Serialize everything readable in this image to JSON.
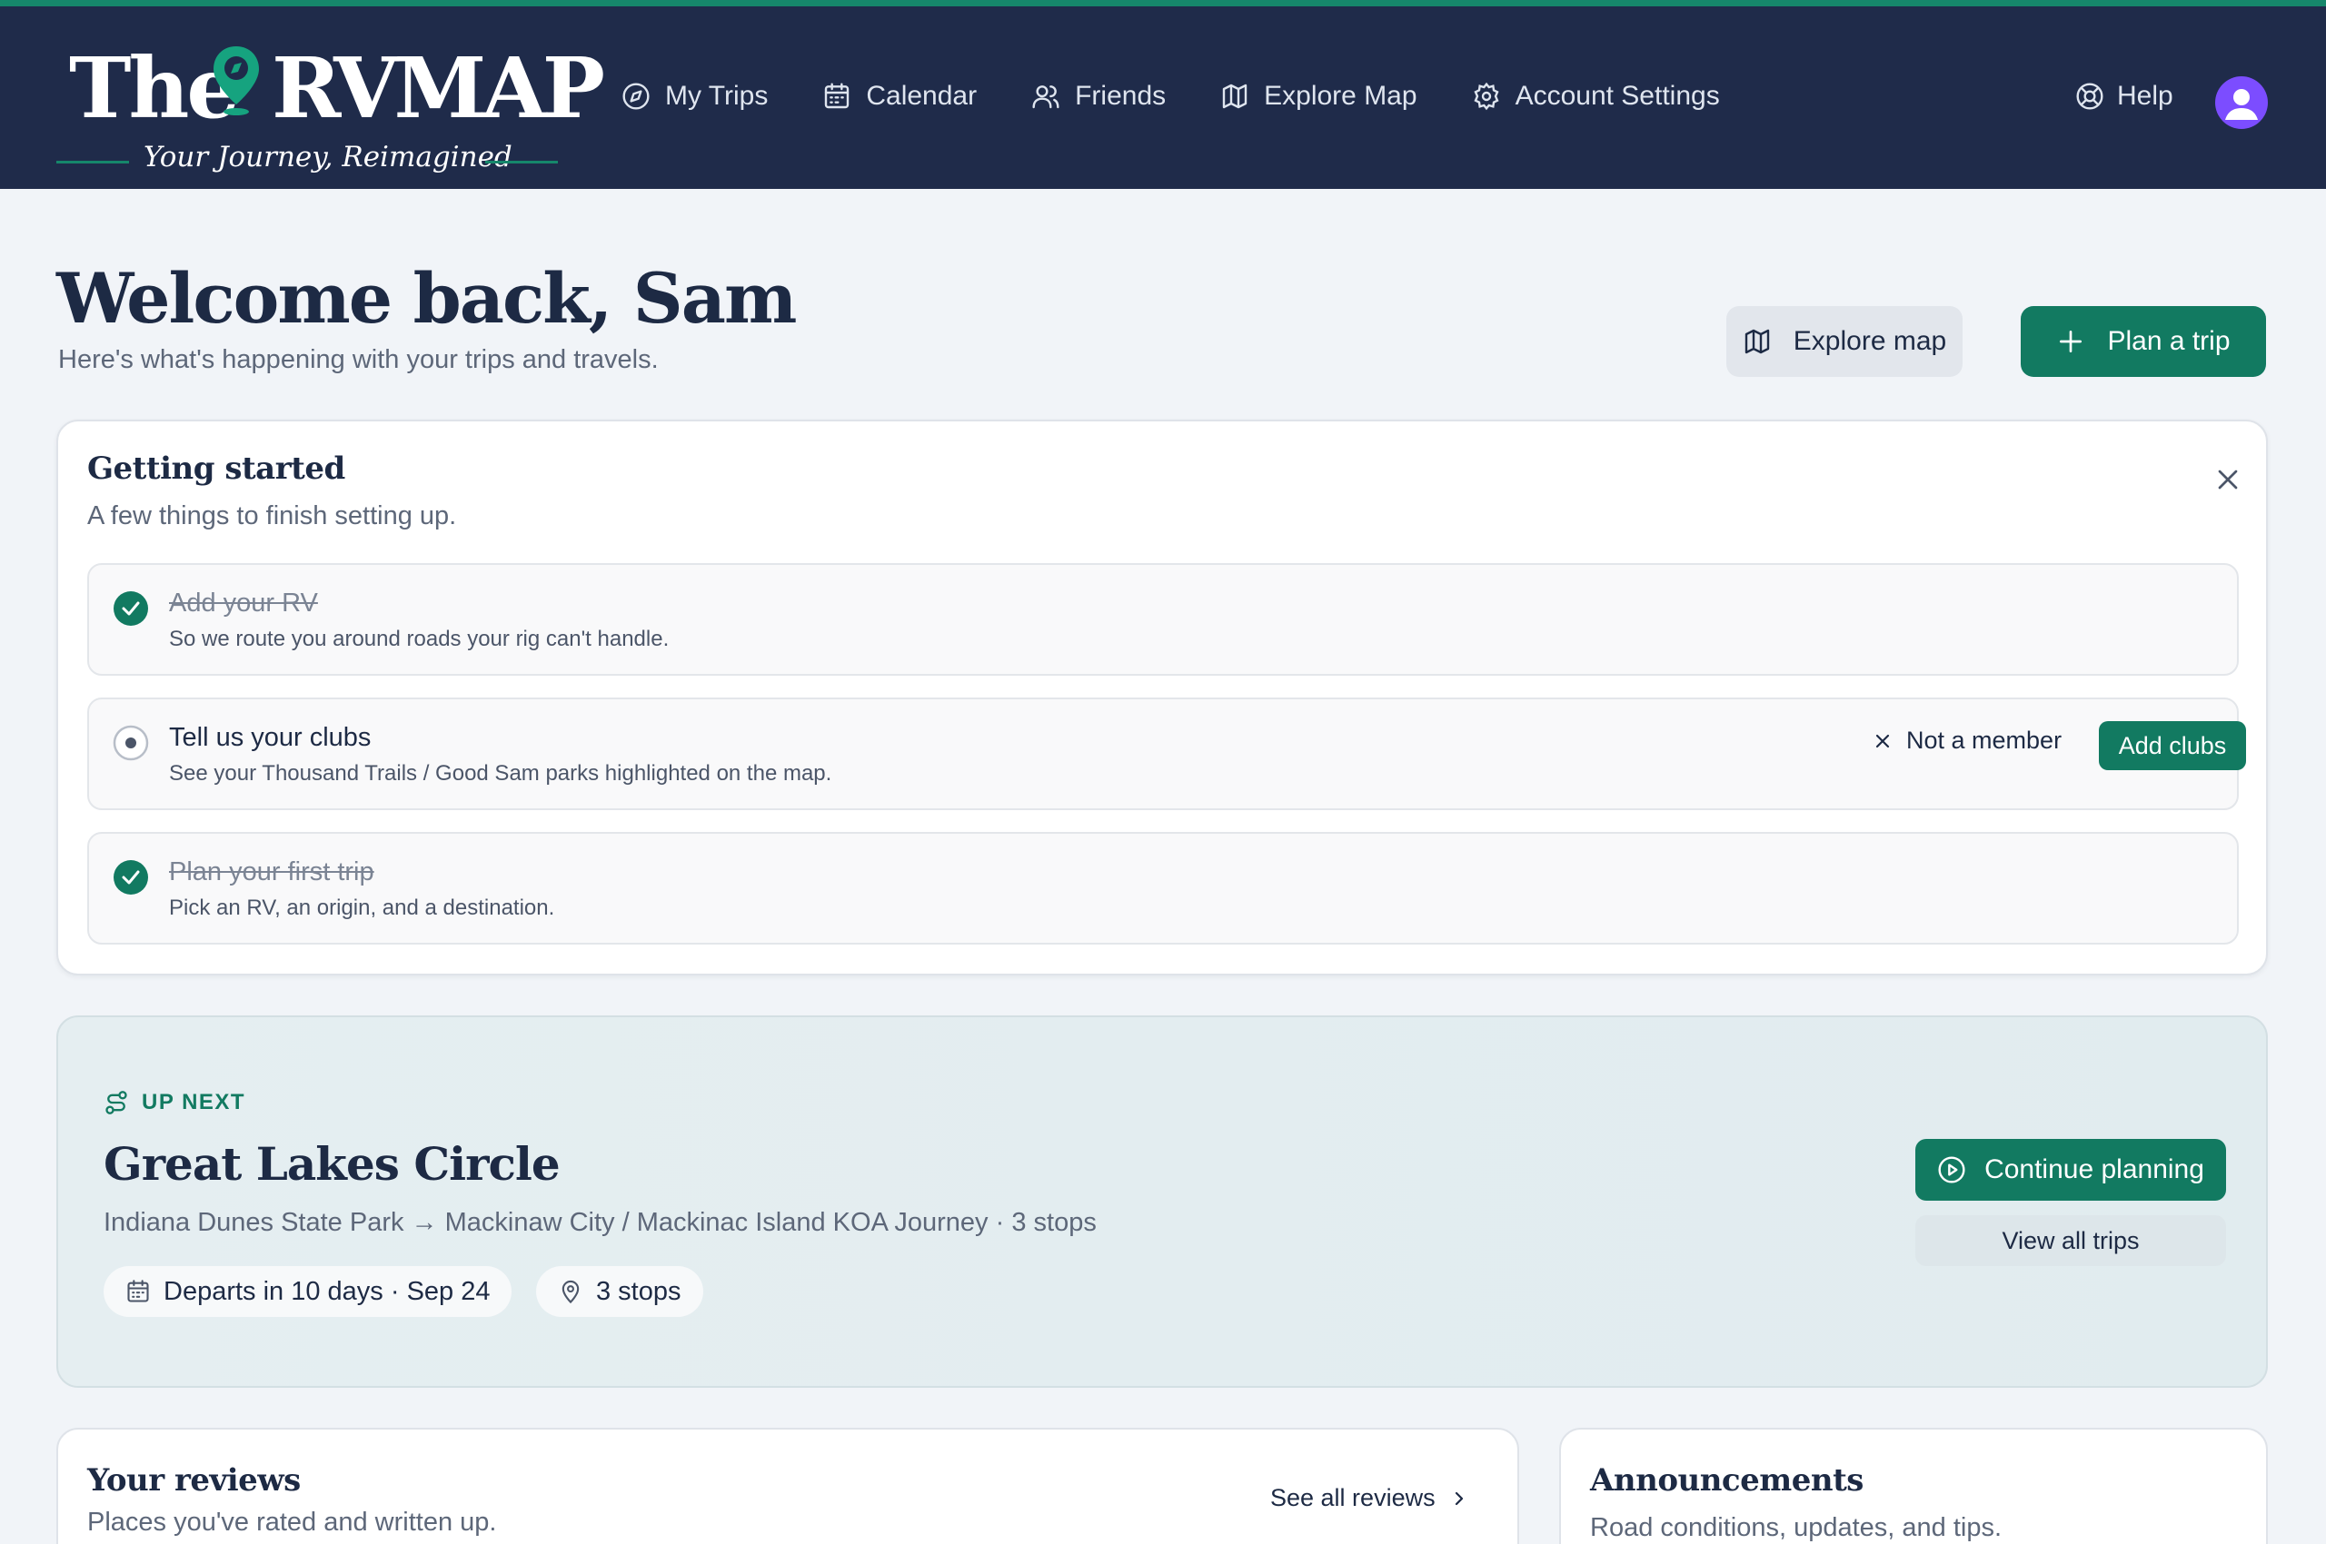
{
  "app": {
    "logo_the": "The",
    "logo_rvmap": "RVMAP",
    "tagline": "Your Journey, Reimagined"
  },
  "nav": {
    "items": [
      {
        "label": "My Trips",
        "icon": "compass-icon"
      },
      {
        "label": "Calendar",
        "icon": "calendar-icon"
      },
      {
        "label": "Friends",
        "icon": "users-icon"
      },
      {
        "label": "Explore Map",
        "icon": "map-icon"
      },
      {
        "label": "Account Settings",
        "icon": "gear-icon"
      }
    ],
    "help_label": "Help"
  },
  "header": {
    "title": "Welcome back, Sam",
    "subtitle": "Here's what's happening with your trips and travels.",
    "explore_label": "Explore map",
    "plan_label": "Plan a trip"
  },
  "getting_started": {
    "title": "Getting started",
    "subtitle": "A few things to finish setting up.",
    "tasks": [
      {
        "title": "Add your RV",
        "desc": "So we route you around roads your rig can't handle.",
        "done": true
      },
      {
        "title": "Tell us your clubs",
        "desc": "See your Thousand Trails / Good Sam parks highlighted on the map.",
        "done": false,
        "not_member_label": "Not a member",
        "action_label": "Add clubs"
      },
      {
        "title": "Plan your first trip",
        "desc": "Pick an RV, an origin, and a destination.",
        "done": true
      }
    ]
  },
  "up_next": {
    "label": "UP NEXT",
    "trip_title": "Great Lakes Circle",
    "route": "Indiana Dunes State Park → Mackinaw City / Mackinac Island KOA Journey · 3 stops",
    "departs": "Departs in 10 days · Sep 24",
    "stops": "3 stops",
    "continue_label": "Continue planning",
    "view_all_label": "View all trips"
  },
  "reviews": {
    "title": "Your reviews",
    "subtitle": "Places you've rated and written up.",
    "see_all_label": "See all reviews"
  },
  "announcements": {
    "title": "Announcements",
    "subtitle": "Road conditions, updates, and tips."
  },
  "colors": {
    "nav_bg": "#1f2b4a",
    "accent": "#127a61",
    "accent_bright": "#16876b",
    "avatar": "#7c4dff",
    "page_bg": "#f1f4f8"
  }
}
